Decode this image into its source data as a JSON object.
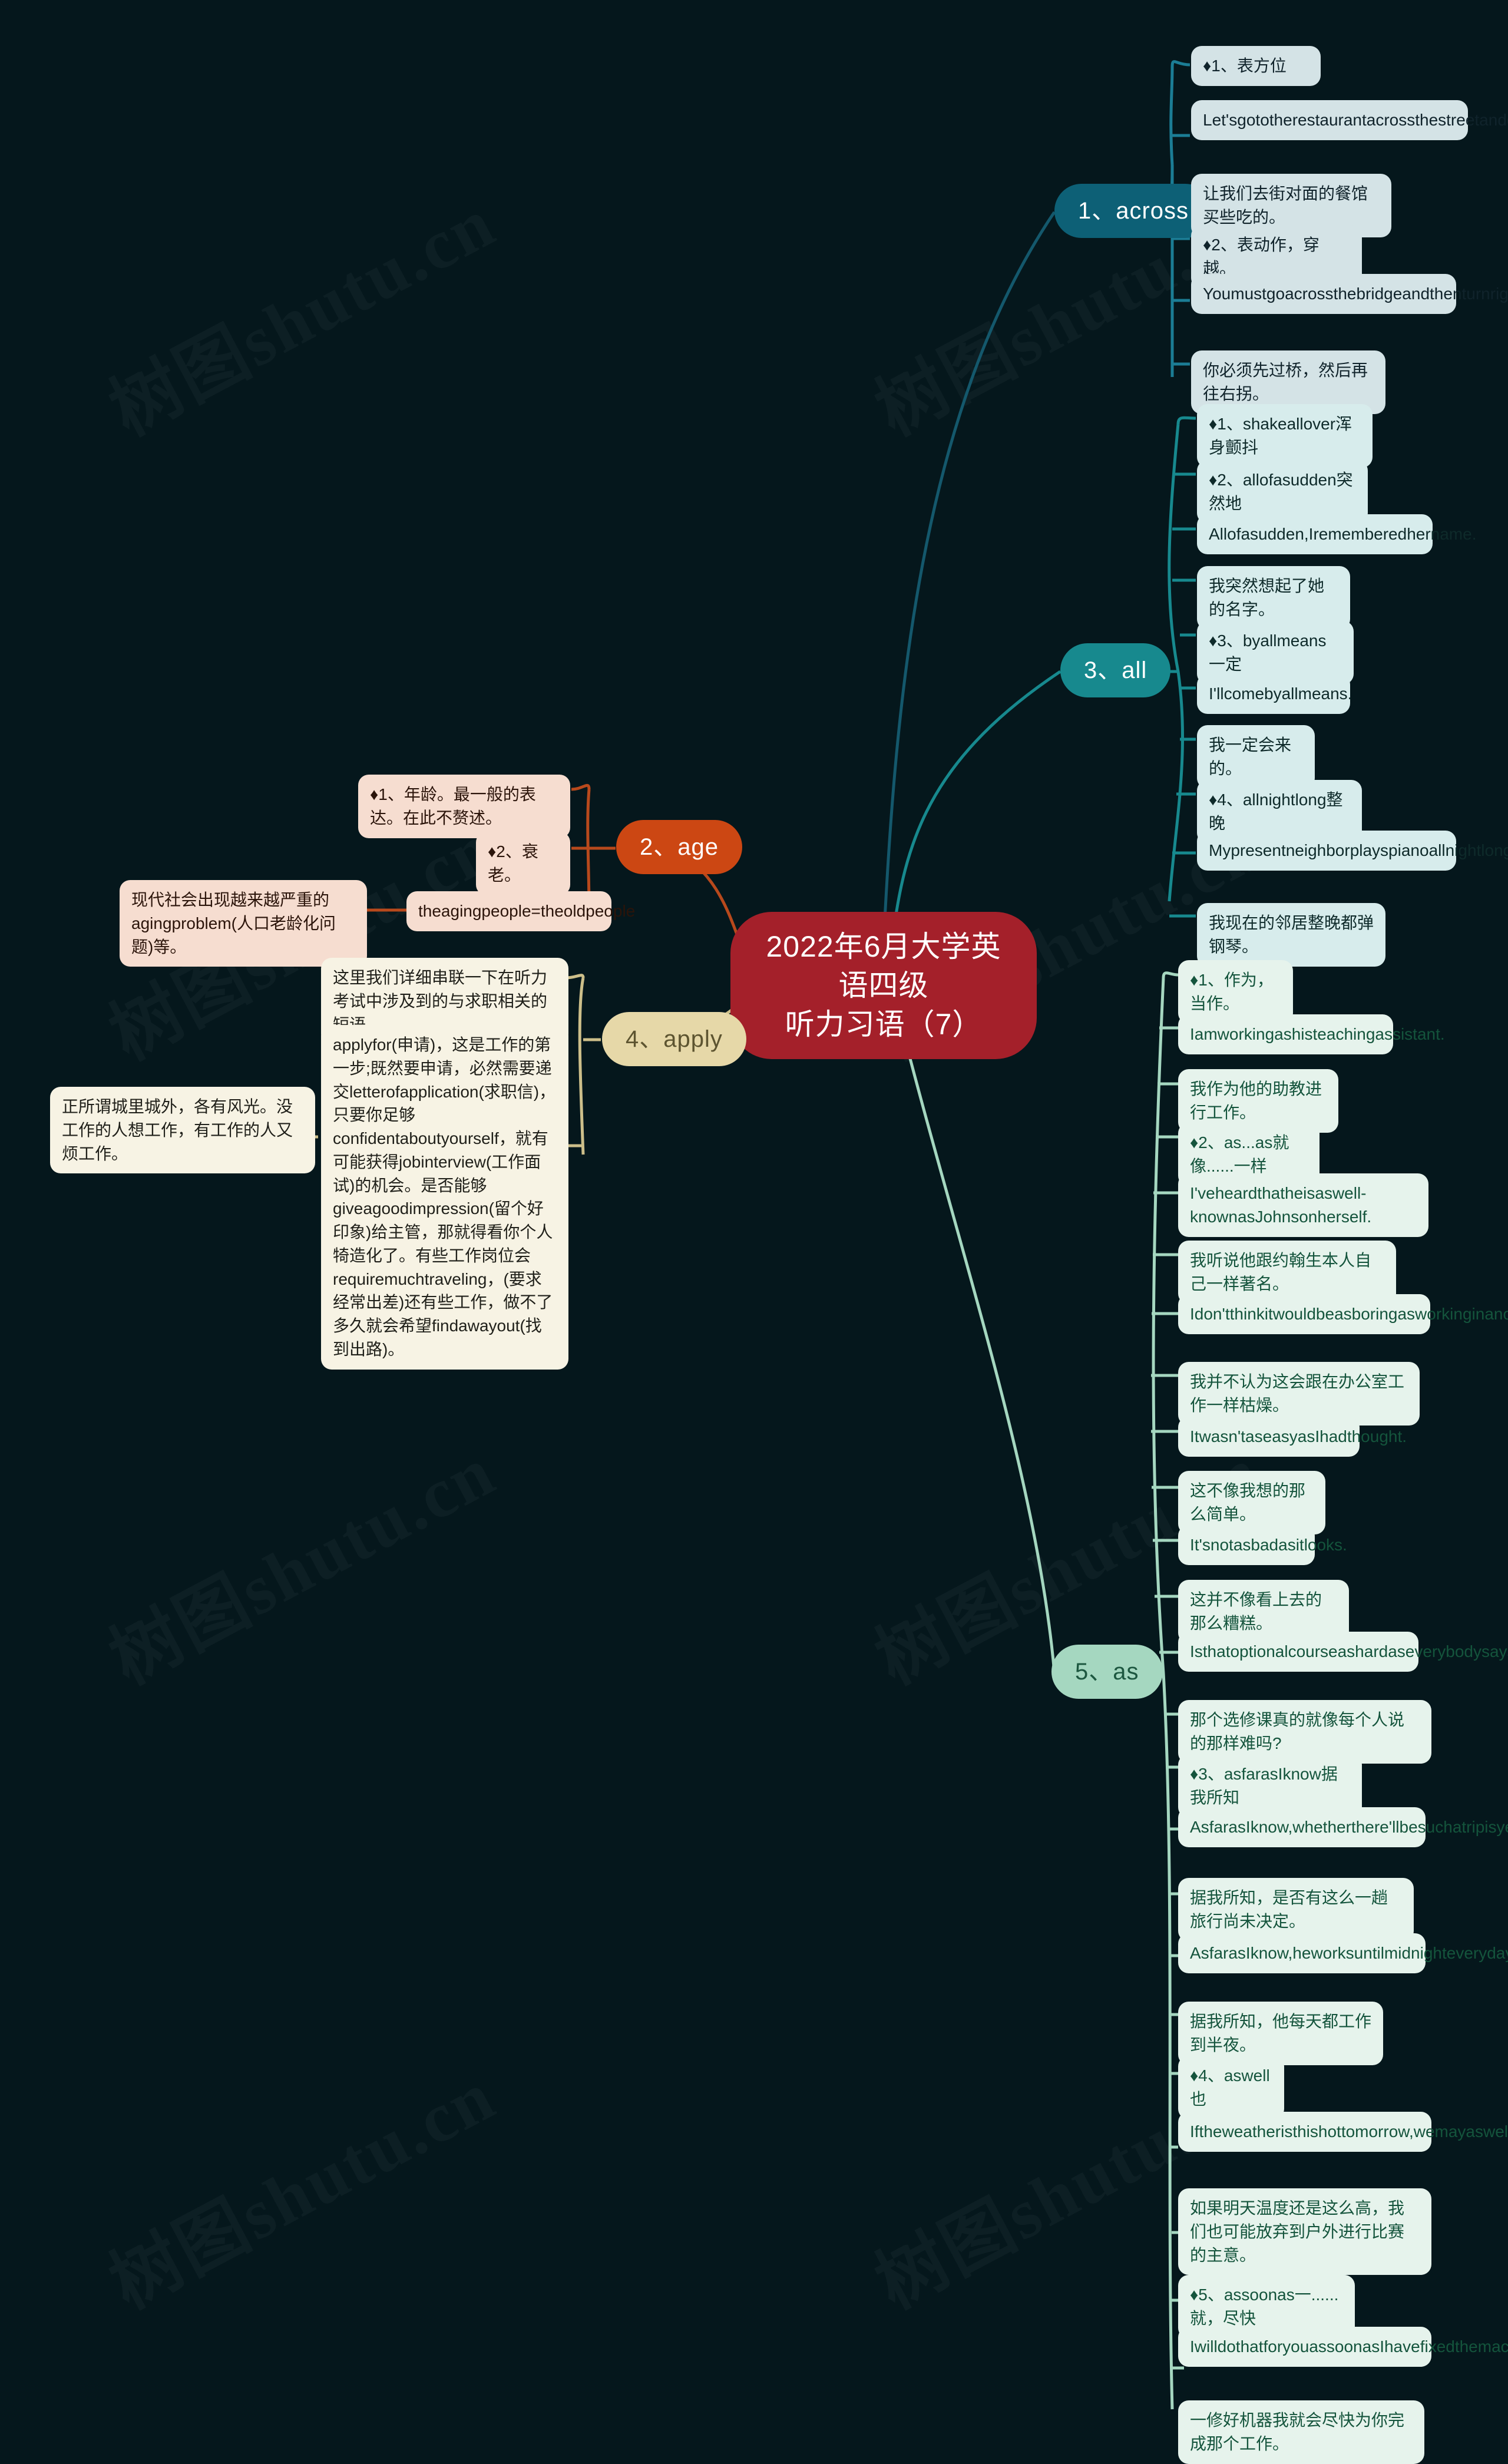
{
  "root": {
    "title": "2022年6月大学英语四级\n听力习语（7）",
    "color": "#a4202a"
  },
  "watermarks": [
    "树图shutu.cn",
    "树图shutu.cn",
    "树图shutu.cn",
    "树图shutu.cn",
    "树图shutu.cn",
    "树图shutu.cn"
  ],
  "branches": [
    {
      "id": "across",
      "label": "1、across",
      "color": "#0d6076",
      "leaf_color": "#d4e3e6",
      "leaves": [
        {
          "text": "♦1、表方位"
        },
        {
          "text": "Let'sgototherestaurantacrossthestreetandgetsomethingtoeat."
        },
        {
          "text": "让我们去街对面的餐馆买些吃的。"
        },
        {
          "text": "♦2、表动作，穿越。"
        },
        {
          "text": "Youmustgoacrossthebridgeandthenturnright."
        },
        {
          "text": "你必须先过桥，然后再往右拐。"
        }
      ]
    },
    {
      "id": "age",
      "label": "2、age",
      "color": "#cc4713",
      "leaf_color": "#f6ddd0",
      "leaves": [
        {
          "text": "♦1、年龄。最一般的表达。在此不赘述。"
        },
        {
          "text": "♦2、衰老。"
        },
        {
          "text": "theagingpeople=theoldpeople"
        },
        {
          "text": "现代社会出现越来越严重的agingproblem(人口老龄化问题)等。"
        }
      ]
    },
    {
      "id": "all",
      "label": "3、all",
      "color": "#17898e",
      "leaf_color": "#d7ecec",
      "leaves": [
        {
          "text": "♦1、shakeallover浑身颤抖"
        },
        {
          "text": "♦2、allofasudden突然地"
        },
        {
          "text": "Allofasudden,Irememberedhername."
        },
        {
          "text": "我突然想起了她的名字。"
        },
        {
          "text": "♦3、byallmeans一定"
        },
        {
          "text": "I'llcomebyallmeans."
        },
        {
          "text": "我一定会来的。"
        },
        {
          "text": "♦4、allnightlong整晚"
        },
        {
          "text": "Mypresentneighborplayspianoallnightlong."
        },
        {
          "text": "我现在的邻居整晚都弹钢琴。"
        }
      ]
    },
    {
      "id": "apply",
      "label": "4、apply",
      "color": "#e6d8a8",
      "leaf_color": "#f7f3e4",
      "leaves": [
        {
          "text": "这里我们详细串联一下在听力考试中涉及到的与求职相关的短语。"
        },
        {
          "text": "applyfor(申请)，这是工作的第一步;既然要申请，必然需要递交letterofapplication(求职信)，只要你足够confidentaboutyourself，就有可能获得jobinterview(工作面试)的机会。是否能够giveagoodimpression(留个好印象)给主管，那就得看你个人犄造化了。有些工作岗位会requiremuchtraveling，(要求经常出差)还有些工作，做不了多久就会希望findawayout(找到出路)。"
        },
        {
          "text": "正所谓城里城外，各有风光。没工作的人想工作，有工作的人又烦工作。"
        }
      ]
    },
    {
      "id": "as",
      "label": "5、as",
      "color": "#a5d7c0",
      "leaf_color": "#e6f3ec",
      "leaves": [
        {
          "text": "♦1、作为，当作。"
        },
        {
          "text": "Iamworkingashisteachingassistant."
        },
        {
          "text": "我作为他的助教进行工作。"
        },
        {
          "text": "♦2、as...as就像......一样"
        },
        {
          "text": "I'veheardthatheisaswell-knownasJohnsonherself."
        },
        {
          "text": "我听说他跟约翰生本人自己一样著名。"
        },
        {
          "text": "Idon'tthinkitwouldbeasboringasworkinginanoffice."
        },
        {
          "text": "我并不认为这会跟在办公室工作一样枯燥。"
        },
        {
          "text": "Itwasn'taseasyasIhadthought."
        },
        {
          "text": "这不像我想的那么简单。"
        },
        {
          "text": "It'snotasbadasitlooks."
        },
        {
          "text": "这并不像看上去的那么糟糕。"
        },
        {
          "text": "Isthatoptionalcourseashardaseverybodysays?"
        },
        {
          "text": "那个选修课真的就像每个人说的那样难吗?"
        },
        {
          "text": "♦3、asfarasIknow据我所知"
        },
        {
          "text": "AsfarasIknow,whetherthere'llbesuchatripisyettobedecided."
        },
        {
          "text": "据我所知，是否有这么一趟旅行尚未决定。"
        },
        {
          "text": "AsfarasIknow,heworksuntilmidnighteveryday."
        },
        {
          "text": "据我所知，他每天都工作到半夜。"
        },
        {
          "text": "♦4、aswell也"
        },
        {
          "text": "Iftheweatheristhishottomorrow,wemayaswellgiveuptheideaofplayingtennisoutside."
        },
        {
          "text": "如果明天温度还是这么高，我们也可能放弃到户外进行比赛的主意。"
        },
        {
          "text": "♦5、assoonas一......就，尽快"
        },
        {
          "text": "IwilldothatforyouassoonasIhavefixedthemachine."
        },
        {
          "text": "一修好机器我就会尽快为你完成那个工作。"
        }
      ]
    }
  ]
}
